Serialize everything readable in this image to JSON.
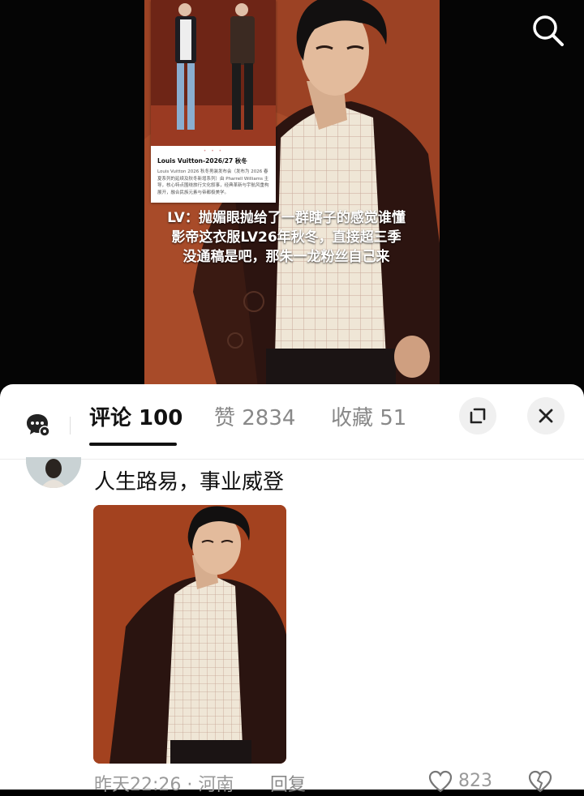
{
  "video": {
    "inset_card": {
      "dots": "• • •",
      "title": "Louis Vuitton-2026/27 秋冬",
      "body": "Louis Vuitton 2026 秋冬男装发布会（发布为 2026 春夏系列的延续及秋冬新增系列）由 Pharrell Williams 主导，核心特点围绕旅行文化叙事，经典革新与宇航风重构展开，融合民族元素与帝都极美学。"
    },
    "caption_lines": [
      "LV：抛媚眼抛给了一群瞎子的感觉谁懂",
      "影帝这衣服LV26年秋冬，直接超三季",
      "没通稿是吧，那朱一龙粉丝自己来"
    ]
  },
  "comment_panel": {
    "tabs": [
      {
        "label": "评论 100"
      },
      {
        "label": "赞 2834"
      },
      {
        "label": "收藏 51"
      }
    ]
  },
  "comment": {
    "text": "人生路易，事业威登",
    "time_location": "昨天22:26 · 河南",
    "reply_label": "回复",
    "likes": "823"
  },
  "icons": {
    "search": "search-icon",
    "chat": "chat-bubble-icon",
    "expand": "expand-icon",
    "close": "close-icon",
    "like": "heart-icon",
    "dislike": "broken-heart-icon"
  },
  "colors": {
    "background": "#000000",
    "sheet": "#ffffff",
    "active_tab": "#111111",
    "inactive_tab": "#888888",
    "photo_backdrop": "#a9482a"
  }
}
